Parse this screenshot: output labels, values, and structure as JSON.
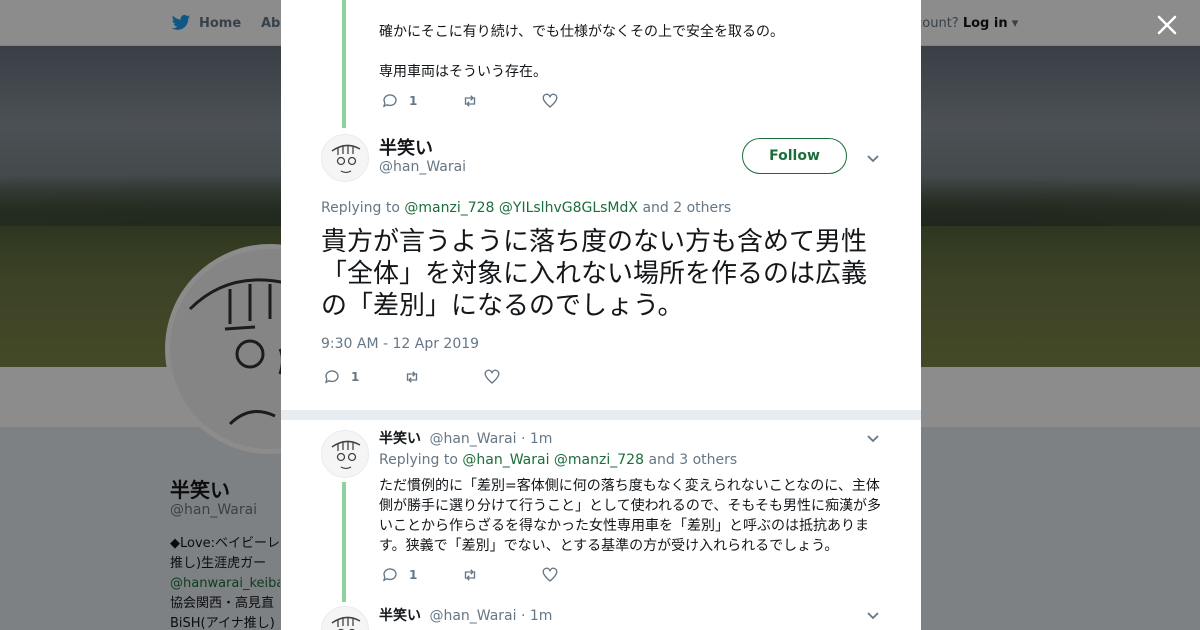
{
  "nav": {
    "home_label": "Home",
    "about_label": "Abo",
    "account_prompt": "account?",
    "login_label": "Log in"
  },
  "profile": {
    "name": "半笑い",
    "handle": "@han_Warai",
    "bio_lines": [
      "◆Love:ベイビーレ",
      "推し)生涯虎ガー",
      "@hanwarai_keiba",
      "協会関西・高見直",
      "BiSH(アイナ推し)"
    ]
  },
  "previous_tweet": {
    "lines": [
      "確かにそこに有り続け、でも仕様がなくその上で安全を取るの。",
      "専用車両はそういう存在。"
    ],
    "reply_count": "1"
  },
  "main_tweet": {
    "name": "半笑い",
    "handle": "@han_Warai",
    "follow_label": "Follow",
    "replying_prefix": "Replying to",
    "mention_1": "@manzi_728",
    "mention_2": "@YILslhvG8GLsMdX",
    "replying_suffix": "and 2 others",
    "text": "貴方が言うように落ち度のない方も含めて男性「全体」を対象に入れない場所を作るのは広義の「差別」になるのでしょう。",
    "timestamp": "9:30 AM - 12 Apr 2019",
    "reply_count": "1"
  },
  "replies": [
    {
      "name": "半笑い",
      "handle": "@han_Warai",
      "time": "· 1m",
      "replying_prefix": "Replying to",
      "mention_1": "@han_Warai",
      "mention_2": "@manzi_728",
      "replying_suffix": "and 3 others",
      "text": "ただ慣例的に「差別=客体側に何の落ち度もなく変えられないことなのに、主体側が勝手に選り分けて行うこと」として使われるので、そもそも男性に痴漢が多いことから作らざるを得なかった女性専用車を「差別」と呼ぶのは抵抗あります。狭義で「差別」でない、とする基準の方が受け入れられるでしょう。",
      "reply_count": "1"
    },
    {
      "name": "半笑い",
      "handle": "@han_Warai",
      "time": "· 1m"
    }
  ],
  "colors": {
    "accent": "#1b6e3b",
    "thread_line": "#8ed1a1",
    "muted": "#657786",
    "text": "#14171a"
  }
}
